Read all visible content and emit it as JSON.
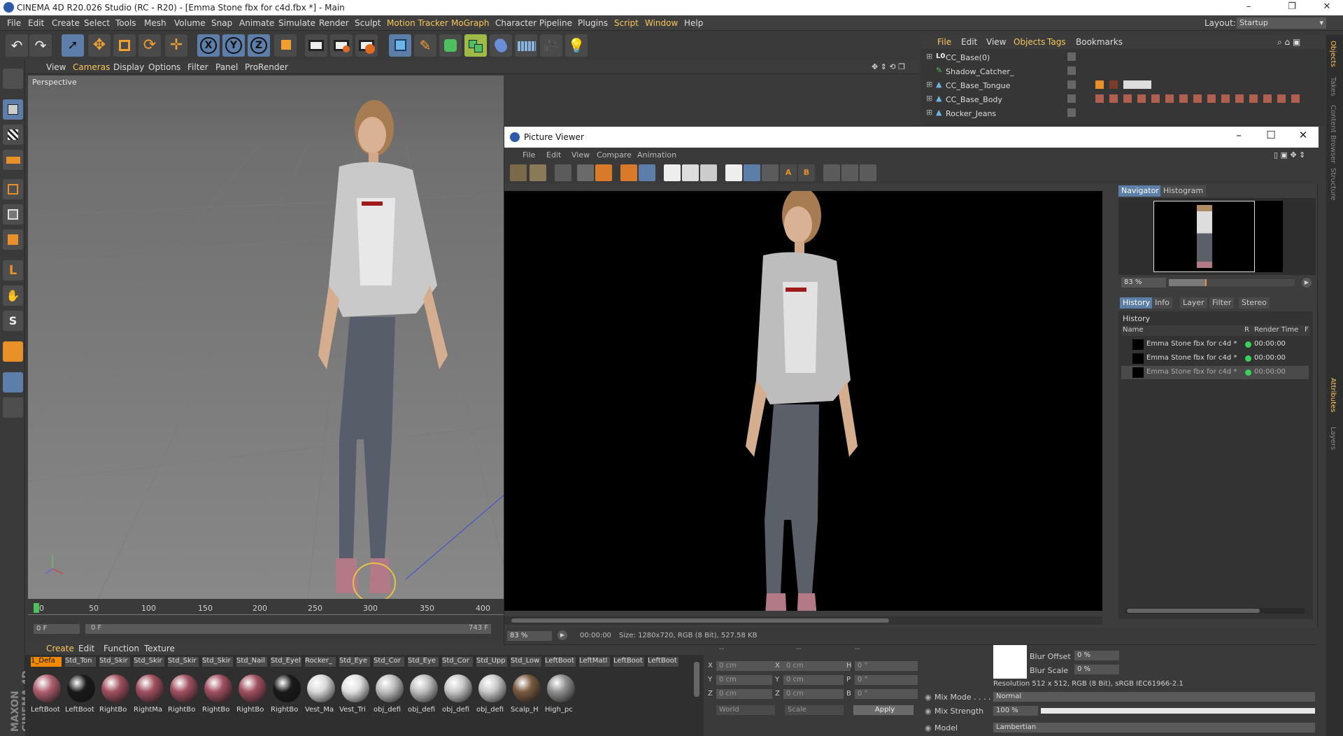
{
  "window": {
    "title": "CINEMA 4D R20.026 Studio (RC - R20) - [Emma Stone fbx for c4d.fbx *] - Main",
    "controls": [
      "–",
      "❐",
      "✕"
    ]
  },
  "menubar": {
    "items": [
      "File",
      "Edit",
      "Create",
      "Select",
      "Tools",
      "Mesh",
      "Volume",
      "Snap",
      "Animate",
      "Simulate",
      "Render",
      "Sculpt",
      "Motion Tracker",
      "MoGraph",
      "Character",
      "Pipeline",
      "Plugins",
      "Script",
      "Window",
      "Help"
    ],
    "layout_label": "Layout:",
    "layout_value": "Startup"
  },
  "viewport": {
    "menu": [
      "View",
      "Cameras",
      "Display",
      "Options",
      "Filter",
      "Panel",
      "ProRender"
    ],
    "label": "Perspective"
  },
  "timeline": {
    "ticks": [
      "0",
      "50",
      "100",
      "150",
      "200",
      "250",
      "300",
      "350",
      "400"
    ],
    "current_frame": "0 F",
    "start_frame": "0 F",
    "end_frame": "743 F"
  },
  "material_manager": {
    "menu": [
      "Create",
      "Edit",
      "Function",
      "Texture"
    ],
    "materials": [
      {
        "top": "1_Defa",
        "bottom": "LeftBoot",
        "color": "#b06070",
        "selected": true
      },
      {
        "top": "Std_Ton",
        "bottom": "LeftBoot",
        "color": "#1a1a1a",
        "selected": false
      },
      {
        "top": "Std_Skir",
        "bottom": "RightBo",
        "color": "#a05060",
        "selected": false
      },
      {
        "top": "Std_Skir",
        "bottom": "RightMa",
        "color": "#a05060",
        "selected": false
      },
      {
        "top": "Std_Skir",
        "bottom": "RightBo",
        "color": "#a05060",
        "selected": false
      },
      {
        "top": "Std_Skir",
        "bottom": "RightBo",
        "color": "#a05060",
        "selected": false
      },
      {
        "top": "Std_Nail",
        "bottom": "RightBo",
        "color": "#a05060",
        "selected": false
      },
      {
        "top": "Std_Eyel",
        "bottom": "RightBo",
        "color": "#1a1a1a",
        "selected": false
      },
      {
        "top": "Rocker_",
        "bottom": "Vest_Ma",
        "color": "#d8d8d8",
        "selected": false
      },
      {
        "top": "Std_Eye",
        "bottom": "Vest_Tri",
        "color": "#e0e0e0",
        "selected": false
      },
      {
        "top": "Std_Cor",
        "bottom": "obj_defi",
        "color": "#bfbfbf",
        "selected": false
      },
      {
        "top": "Std_Eye",
        "bottom": "obj_defi",
        "color": "#bfbfbf",
        "selected": false
      },
      {
        "top": "Std_Cor",
        "bottom": "obj_defi",
        "color": "#c8c8c8",
        "selected": false
      },
      {
        "top": "Std_Upp",
        "bottom": "obj_defi",
        "color": "#c8c8c8",
        "selected": false
      },
      {
        "top": "Std_Low",
        "bottom": "Scalp_H",
        "color": "#7a5a40",
        "selected": false
      },
      {
        "top": "LeftBoot",
        "bottom": "High_pc",
        "color": "#909090",
        "selected": false
      },
      {
        "top": "LeftMatl",
        "bottom": "",
        "color": "",
        "selected": false
      },
      {
        "top": "LeftBoot",
        "bottom": "",
        "color": "",
        "selected": false
      },
      {
        "top": "LeftBoot",
        "bottom": "",
        "color": "",
        "selected": false
      }
    ]
  },
  "coordinates": {
    "header": "--",
    "rows": [
      {
        "a": "X",
        "av": "0 cm",
        "b": "X",
        "bv": "0 cm",
        "c": "H",
        "cv": "0 °"
      },
      {
        "a": "Y",
        "av": "0 cm",
        "b": "Y",
        "bv": "0 cm",
        "c": "P",
        "cv": "0 °"
      },
      {
        "a": "Z",
        "av": "0 cm",
        "b": "Z",
        "bv": "0 cm",
        "c": "B",
        "cv": "0 °"
      }
    ],
    "mode1": "World",
    "mode2": "Scale",
    "apply": "Apply"
  },
  "object_manager": {
    "menu": [
      "File",
      "Edit",
      "View",
      "Objects",
      "Tags",
      "Bookmarks"
    ],
    "objects": [
      "CC_Base(0)",
      "Shadow_Catcher_",
      "CC_Base_Tongue",
      "CC_Base_Body",
      "Rocker_Jeans"
    ]
  },
  "side_tabs": [
    "Objects",
    "Takes",
    "Content Browser",
    "Structure",
    "Attributes",
    "Layers"
  ],
  "attributes": {
    "blur_offset_label": "Blur Offset",
    "blur_offset": "0 %",
    "blur_scale_label": "Blur Scale",
    "blur_scale": "0 %",
    "resolution": "Resolution 512 x 512, RGB (8 Bit), sRGB IEC61966-2.1",
    "mix_mode_label": "Mix Mode . . . .",
    "mix_mode": "Normal",
    "mix_strength_label": "Mix Strength",
    "mix_strength": "100 %",
    "mix_strength_level": 1.0,
    "model_label": "Model",
    "model": "Lambertian"
  },
  "picture_viewer": {
    "title": "Picture Viewer",
    "menu": [
      "File",
      "Edit",
      "View",
      "Compare",
      "Animation"
    ],
    "nav_tabs": [
      "Navigator",
      "Histogram"
    ],
    "zoom": "83 %",
    "zoom_level": 0.3,
    "info_tabs": [
      "History",
      "Info",
      "Layer",
      "Filter",
      "Stereo"
    ],
    "history_label": "History",
    "columns": [
      "Name",
      "R",
      "Render Time",
      "F"
    ],
    "history": [
      {
        "name": "Emma Stone fbx for c4d *",
        "time": "00:00:00"
      },
      {
        "name": "Emma Stone fbx for c4d *",
        "time": "00:00:00"
      },
      {
        "name": "Emma Stone fbx for c4d *",
        "time": "00:00:00"
      }
    ],
    "status_zoom": "83 %",
    "status_time": "00:00:00",
    "status_size": "Size: 1280x720, RGB (8 Bit), 527.58 KB"
  },
  "colors": {
    "accent": "#f7c75a",
    "selection": "#5c7fa8",
    "status_ok": "#3ad15c"
  }
}
